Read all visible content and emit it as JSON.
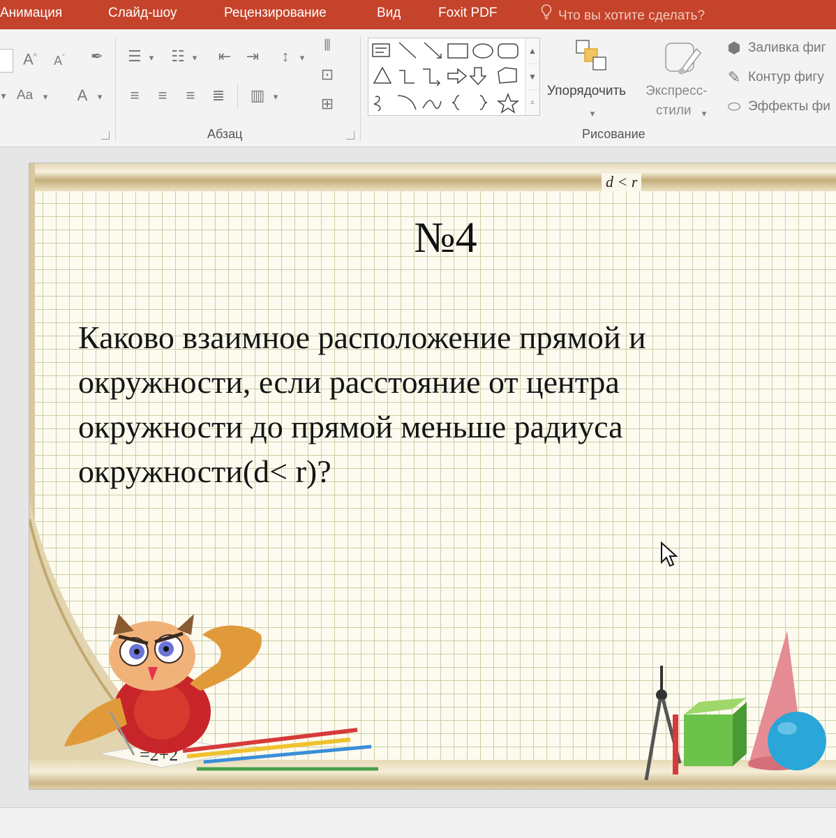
{
  "tabs": [
    "Анимация",
    "Слайд-шоу",
    "Рецензирование",
    "Вид",
    "Foxit PDF"
  ],
  "tell_me": "Что вы хотите сделать?",
  "ribbon": {
    "font_case_label": "Aa",
    "paragraph_group": "Абзац",
    "arrange_label": "Упорядочить",
    "quick_styles_label_1": "Экспресс-",
    "quick_styles_label_2": "стили",
    "shape_fill": "Заливка фиг",
    "shape_outline": "Контур фигу",
    "shape_effects": "Эффекты фи",
    "drawing_group": "Рисование"
  },
  "slide": {
    "header_formula": "d < r",
    "number": "№4",
    "question": "Каково взаимное расположение прямой и окружности, если расстояние от центра окружности до прямой меньше радиуса окружности(d< r)?",
    "owl_paper_text": "=2+2"
  },
  "colors": {
    "ribbon_tab_bar": "#c4432a",
    "ribbon_body": "#f3f3f3",
    "slide_background": "#fdfbf0",
    "grid_lines": "#c9cda6"
  }
}
